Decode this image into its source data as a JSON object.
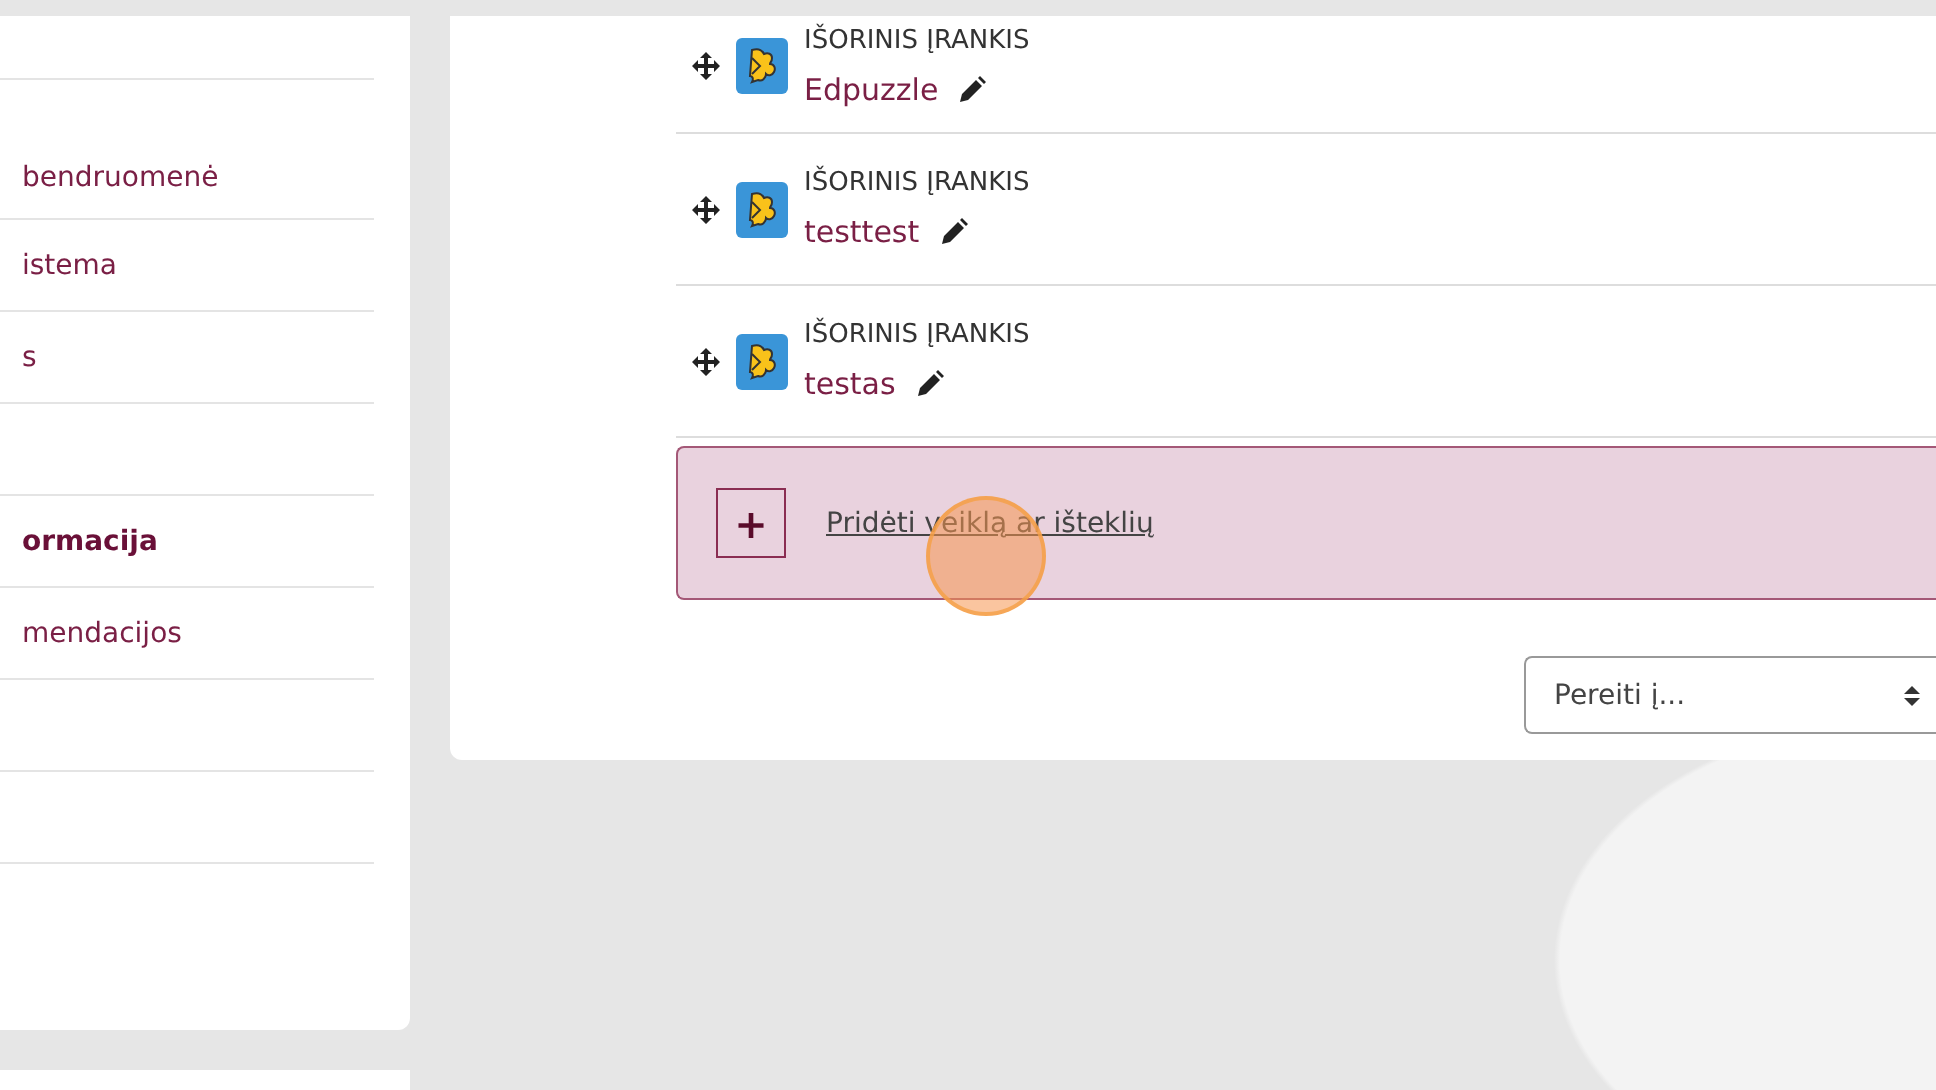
{
  "sidebar": {
    "items": [
      {
        "kind": "link",
        "label": "bendruomenė",
        "selected": false
      },
      {
        "kind": "link",
        "label": "istema",
        "selected": false
      },
      {
        "kind": "link",
        "label": "s",
        "selected": false
      },
      {
        "kind": "blank"
      },
      {
        "kind": "link",
        "label": "ormacija",
        "selected": true
      },
      {
        "kind": "link",
        "label": "mendacijos",
        "selected": false
      },
      {
        "kind": "blank"
      },
      {
        "kind": "blank"
      }
    ]
  },
  "activities": [
    {
      "type": "IŠORINIS ĮRANKIS",
      "name": "Edpuzzle"
    },
    {
      "type": "IŠORINIS ĮRANKIS",
      "name": "testtest"
    },
    {
      "type": "IŠORINIS ĮRANKIS",
      "name": "testas"
    }
  ],
  "add_activity": {
    "button": "+",
    "link": "Pridėti veiklą ar išteklių"
  },
  "jump_select": {
    "value": "Pereiti į..."
  }
}
